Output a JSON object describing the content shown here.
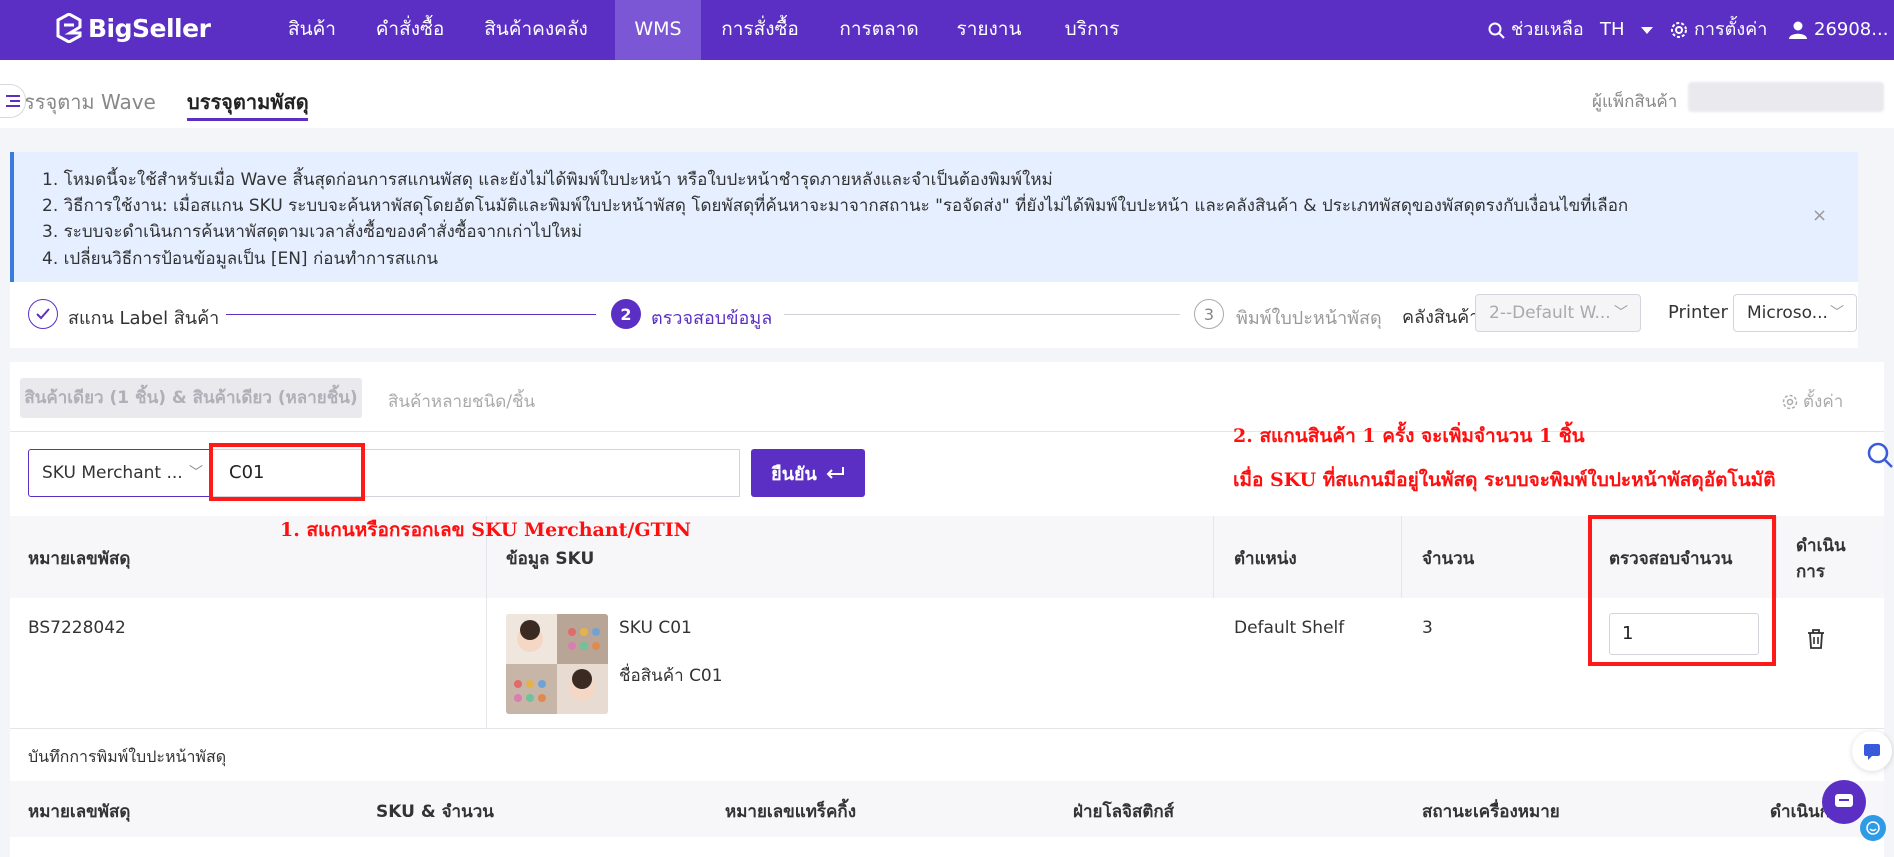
{
  "app": {
    "logo_text": "BigSeller"
  },
  "nav": {
    "items": [
      "สินค้า",
      "คำสั่งซื้อ",
      "สินค้าคงคลัง",
      "WMS",
      "การสั่งซื้อ",
      "การตลาด",
      "รายงาน",
      "บริการ"
    ],
    "active": "WMS",
    "help": "ช่วยเหลือ",
    "language": "TH",
    "settings": "การตั้งค่า",
    "user": "26908..."
  },
  "tabs": {
    "wave": "รรจุตาม Wave",
    "parcel": "บรรจุตามพัสดุ",
    "packer_label": "ผู้แพ็กสินค้า"
  },
  "banner": {
    "lines": [
      "1. โหมดนี้จะใช้สำหรับเมื่อ Wave สิ้นสุดก่อนการสแกนพัสดุ และยังไม่ได้พิมพ์ใบปะหน้า หรือใบปะหน้าชำรุดภายหลังและจำเป็นต้องพิมพ์ใหม่",
      "2. วิธีการใช้งาน: เมื่อสแกน SKU ระบบจะค้นหาพัสดุโดยอัตโนมัติและพิมพ์ใบปะหน้าพัสดุ โดยพัสดุที่ค้นหาจะมาจากสถานะ \"รอจัดส่ง\" ที่ยังไม่ได้พิมพ์ใบปะหน้า และคลังสินค้า & ประเภทพัสดุของพัสดุตรงกับเงื่อนไขที่เลือก",
      "3. ระบบจะดำเนินการค้นหาพัสดุตามเวลาสั่งซื้อของคำสั่งซื้อจากเก่าไปใหม่",
      "4. เปลี่ยนวิธีการป้อนข้อมูลเป็น [EN] ก่อนทำการสแกน"
    ],
    "close": "×"
  },
  "steps": {
    "step1": "สแกน Label สินค้า",
    "step2_num": "2",
    "step2": "ตรวจสอบข้อมูล",
    "step3_num": "3",
    "step3": "พิมพ์ใบปะหน้าพัสดุ",
    "warehouse_label": "คลังสินค้า",
    "warehouse_value": "2--Default W...",
    "printer_label": "Printer",
    "printer_value": "Microso..."
  },
  "subtabs": {
    "single": "สินค้าเดียว (1 ชิ้น) & สินค้าเดียว (หลายชิ้น)",
    "multi": "สินค้าหลายชนิด/ชิ้น",
    "settings": "ตั้งค่า"
  },
  "scan": {
    "type": "SKU Merchant ...",
    "value": "C01",
    "confirm": "ยืนยัน"
  },
  "table": {
    "headers": {
      "parcel_no": "หมายเลขพัสดุ",
      "sku_info": "ข้อมูล SKU",
      "location": "ตำแหน่ง",
      "quantity": "จำนวน",
      "verify_qty": "ตรวจสอบจำนวน",
      "action_1": "ดำเนิน",
      "action_2": "การ"
    },
    "rows": [
      {
        "parcel_no": "BS7228042",
        "sku": "SKU C01",
        "product_name": "ชื่อสินค้า C01",
        "location": "Default Shelf",
        "quantity": "3",
        "verify_qty": "1"
      }
    ]
  },
  "log": {
    "title": "บันทึกการพิมพ์ใบปะหน้าพัสดุ",
    "headers": [
      "หมายเลขพัสดุ",
      "SKU & จำนวน",
      "หมายเลขแทร็คกิ้ง",
      "ฝ่ายโลจิสติกส์",
      "สถานะเครื่องหมาย",
      "ดำเนินก"
    ]
  },
  "annotations": {
    "note1": "1. สแกนหรือกรอกเลข SKU Merchant/GTIN",
    "note2_line1": "2. สแกนสินค้า 1 ครั้ง จะเพิ่มจำนวน 1 ชิ้น",
    "note2_line2": "เมื่อ SKU ที่สแกนมีอยู่ในพัสดุ ระบบจะพิมพ์ใบปะหน้าพัสดุอัตโนมัติ"
  },
  "colors": {
    "brand": "#5b2fc4",
    "annotation_red": "#ff1a1a",
    "banner_bg": "#e5efff"
  }
}
